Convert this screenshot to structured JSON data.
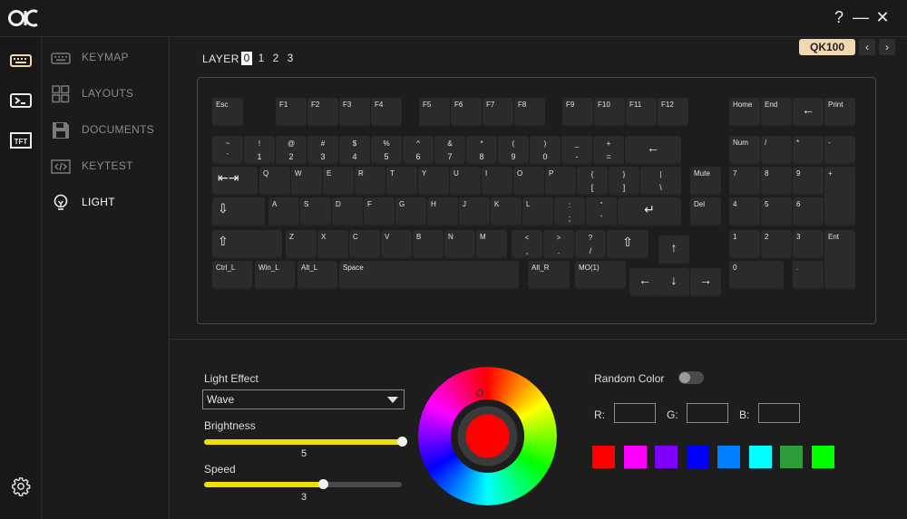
{
  "window": {
    "help_label": "?",
    "minimize_label": "—",
    "close_label": "✕"
  },
  "nav": [
    {
      "name": "keymap",
      "label": "KEYMAP"
    },
    {
      "name": "layouts",
      "label": "LAYOUTS"
    },
    {
      "name": "documents",
      "label": "DOCUMENTS"
    },
    {
      "name": "keytest",
      "label": "KEYTEST"
    },
    {
      "name": "light",
      "label": "LIGHT"
    }
  ],
  "rail": {
    "tft_label": "TFT"
  },
  "layers": {
    "label": "LAYER",
    "items": [
      "0",
      "1",
      "2",
      "3"
    ],
    "active": "0"
  },
  "model": {
    "badge": "QK100",
    "prev": "‹",
    "next": "›"
  },
  "keyboard": {
    "keys": [
      {
        "id": "esc",
        "t": "Esc"
      },
      {
        "id": "f1",
        "t": "F1"
      },
      {
        "id": "f2",
        "t": "F2"
      },
      {
        "id": "f3",
        "t": "F3"
      },
      {
        "id": "f4",
        "t": "F4"
      },
      {
        "id": "f5",
        "t": "F5"
      },
      {
        "id": "f6",
        "t": "F6"
      },
      {
        "id": "f7",
        "t": "F7"
      },
      {
        "id": "f8",
        "t": "F8"
      },
      {
        "id": "f9",
        "t": "F9"
      },
      {
        "id": "f10",
        "t": "F10"
      },
      {
        "id": "f11",
        "t": "F11"
      },
      {
        "id": "f12",
        "t": "F12"
      },
      {
        "id": "home",
        "t": "Home"
      },
      {
        "id": "end",
        "t": "End"
      },
      {
        "id": "bksp_top",
        "big": "←"
      },
      {
        "id": "print",
        "t": "Print"
      },
      {
        "id": "grave",
        "t": "~",
        "b": "`"
      },
      {
        "id": "n1",
        "t": "!",
        "b": "1"
      },
      {
        "id": "n2",
        "t": "@",
        "b": "2"
      },
      {
        "id": "n3",
        "t": "#",
        "b": "3"
      },
      {
        "id": "n4",
        "t": "$",
        "b": "4"
      },
      {
        "id": "n5",
        "t": "%",
        "b": "5"
      },
      {
        "id": "n6",
        "t": "^",
        "b": "6"
      },
      {
        "id": "n7",
        "t": "&",
        "b": "7"
      },
      {
        "id": "n8",
        "t": "*",
        "b": "8"
      },
      {
        "id": "n9",
        "t": "(",
        "b": "9"
      },
      {
        "id": "n0",
        "t": ")",
        "b": "0"
      },
      {
        "id": "minus",
        "t": "_",
        "b": "-"
      },
      {
        "id": "equal",
        "t": "+",
        "b": "="
      },
      {
        "id": "backspace",
        "big": "←"
      },
      {
        "id": "num",
        "t": "Num"
      },
      {
        "id": "kp_slash",
        "t": "/"
      },
      {
        "id": "kp_star",
        "t": "*"
      },
      {
        "id": "kp_minus",
        "t": "-"
      },
      {
        "id": "tab",
        "big": "⇤⇥"
      },
      {
        "id": "q",
        "t": "Q"
      },
      {
        "id": "w",
        "t": "W"
      },
      {
        "id": "e",
        "t": "E"
      },
      {
        "id": "r",
        "t": "R"
      },
      {
        "id": "t",
        "t": "T"
      },
      {
        "id": "y",
        "t": "Y"
      },
      {
        "id": "u",
        "t": "U"
      },
      {
        "id": "i",
        "t": "I"
      },
      {
        "id": "o",
        "t": "O"
      },
      {
        "id": "p",
        "t": "P"
      },
      {
        "id": "lbracket",
        "t": "{",
        "b": "["
      },
      {
        "id": "rbracket",
        "t": "}",
        "b": "]"
      },
      {
        "id": "backslash",
        "t": "|",
        "b": "\\"
      },
      {
        "id": "mute",
        "t": "Mute"
      },
      {
        "id": "kp7",
        "t": "7"
      },
      {
        "id": "kp8",
        "t": "8"
      },
      {
        "id": "kp9",
        "t": "9"
      },
      {
        "id": "kp_plus",
        "t": "+"
      },
      {
        "id": "caps",
        "big": "⇩"
      },
      {
        "id": "a",
        "t": "A"
      },
      {
        "id": "s",
        "t": "S"
      },
      {
        "id": "d",
        "t": "D"
      },
      {
        "id": "f",
        "t": "F"
      },
      {
        "id": "g",
        "t": "G"
      },
      {
        "id": "h",
        "t": "H"
      },
      {
        "id": "j",
        "t": "J"
      },
      {
        "id": "k",
        "t": "K"
      },
      {
        "id": "l",
        "t": "L"
      },
      {
        "id": "semicolon",
        "t": ":",
        "b": ";"
      },
      {
        "id": "quote",
        "t": "\"",
        "b": "'"
      },
      {
        "id": "enter",
        "big": "↵"
      },
      {
        "id": "del",
        "t": "Del"
      },
      {
        "id": "kp4",
        "t": "4"
      },
      {
        "id": "kp5",
        "t": "5"
      },
      {
        "id": "kp6",
        "t": "6"
      },
      {
        "id": "lshift",
        "big": "⇧"
      },
      {
        "id": "z",
        "t": "Z"
      },
      {
        "id": "x",
        "t": "X"
      },
      {
        "id": "c",
        "t": "C"
      },
      {
        "id": "v",
        "t": "V"
      },
      {
        "id": "b",
        "t": "B"
      },
      {
        "id": "n",
        "t": "N"
      },
      {
        "id": "m",
        "t": "M"
      },
      {
        "id": "comma",
        "t": "<",
        "b": ","
      },
      {
        "id": "period",
        "t": ">",
        "b": "."
      },
      {
        "id": "slash",
        "t": "?",
        "b": "/"
      },
      {
        "id": "rshift",
        "big": "⇧"
      },
      {
        "id": "up",
        "big": "↑"
      },
      {
        "id": "kp1",
        "t": "1"
      },
      {
        "id": "kp2",
        "t": "2"
      },
      {
        "id": "kp3",
        "t": "3"
      },
      {
        "id": "kp_enter",
        "t": "Ent"
      },
      {
        "id": "lctrl",
        "t": "Ctrl_L"
      },
      {
        "id": "lwin",
        "t": "Win_L"
      },
      {
        "id": "lalt",
        "t": "Alt_L"
      },
      {
        "id": "space",
        "t": "Space"
      },
      {
        "id": "ralt",
        "t": "Alt_R"
      },
      {
        "id": "mo1",
        "t": "MO(1)"
      },
      {
        "id": "left",
        "big": "←"
      },
      {
        "id": "down",
        "big": "↓"
      },
      {
        "id": "right",
        "big": "→"
      },
      {
        "id": "kp0",
        "t": "0"
      },
      {
        "id": "kp_dot",
        "t": "."
      }
    ]
  },
  "light": {
    "effect_label": "Light Effect",
    "effect_value": "Wave",
    "brightness_label": "Brightness",
    "brightness_value": "5",
    "brightness_max": 5,
    "speed_label": "Speed",
    "speed_value": "3",
    "speed_max": 5,
    "random_color_label": "Random Color",
    "random_color_on": false,
    "r_label": "R:",
    "g_label": "G:",
    "b_label": "B:",
    "r_value": "",
    "g_value": "",
    "b_value": "",
    "selected_color": "#ff0000",
    "presets": [
      "#ff0000",
      "#ff00ff",
      "#8000ff",
      "#0000ff",
      "#0080ff",
      "#00ffff",
      "#2e9c3a",
      "#00ff00"
    ]
  },
  "accent": {
    "slider_fill": "#f0e000",
    "badge": "#f3d7b3"
  }
}
